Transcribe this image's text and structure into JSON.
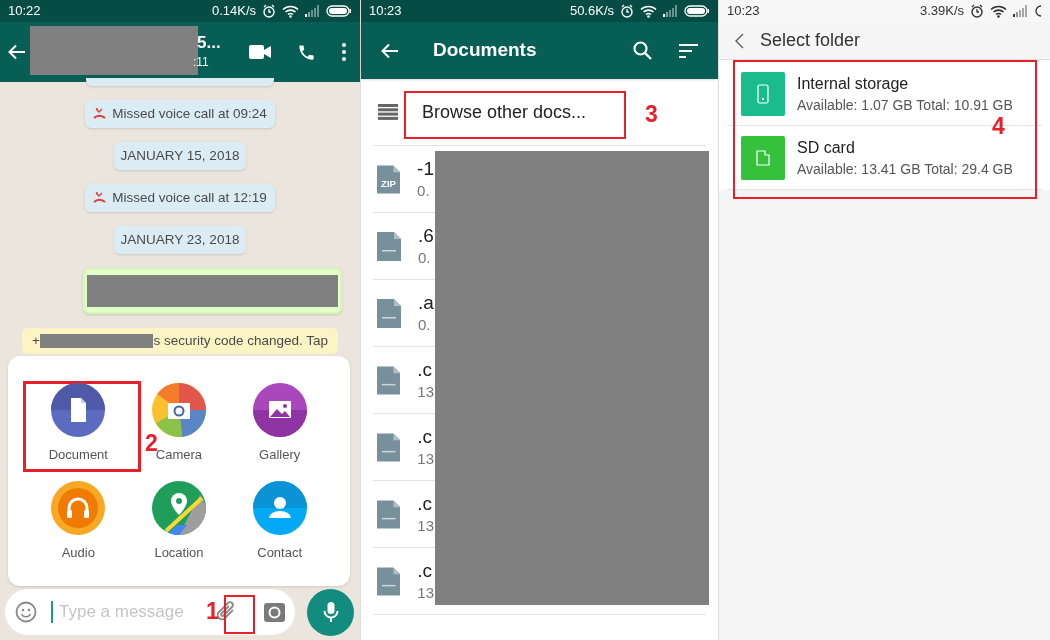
{
  "chat_screen": {
    "status_bar": {
      "time": "10:22",
      "speed": "0.14K/s"
    },
    "header": {
      "name_fragment": "5...",
      "status_fragment": ":11"
    },
    "messages": [
      {
        "kind": "cut"
      },
      {
        "kind": "call",
        "text": "Missed voice call at 09:24"
      },
      {
        "kind": "date",
        "text": "JANUARY 15, 2018"
      },
      {
        "kind": "call",
        "text": "Missed voice call at 12:19"
      },
      {
        "kind": "date",
        "text": "JANUARY 23, 2018"
      },
      {
        "kind": "redacted"
      },
      {
        "kind": "notice",
        "prefix": "+",
        "text": "s security code changed. Tap"
      }
    ],
    "attach_options": [
      {
        "kind": "document",
        "label": "Document"
      },
      {
        "kind": "camera",
        "label": "Camera"
      },
      {
        "kind": "gallery",
        "label": "Gallery"
      },
      {
        "kind": "audio",
        "label": "Audio"
      },
      {
        "kind": "location",
        "label": "Location"
      },
      {
        "kind": "contact",
        "label": "Contact"
      }
    ],
    "input": {
      "placeholder": "Type a message"
    },
    "annotations": [
      {
        "kind": "attach",
        "label": "1"
      },
      {
        "kind": "document",
        "label": "2"
      }
    ]
  },
  "documents_screen": {
    "status_bar": {
      "time": "10:23",
      "speed": "50.6K/s"
    },
    "title": "Documents",
    "browse_label": "Browse other docs...",
    "files": [
      {
        "kind": "zip",
        "icon_label": "ZIP",
        "name": "-1",
        "size": "0."
      },
      {
        "kind": "file",
        "name": ".6",
        "size": "0."
      },
      {
        "kind": "file",
        "name": ".a",
        "size": "0."
      },
      {
        "kind": "file",
        "name": ".c",
        "size": "13"
      },
      {
        "kind": "file",
        "name": ".c",
        "size": "13"
      },
      {
        "kind": "file",
        "name": ".c",
        "size": "13"
      },
      {
        "kind": "file",
        "name": ".c",
        "size": "13"
      }
    ],
    "annotation": {
      "label": "3"
    }
  },
  "folder_screen": {
    "status_bar": {
      "time": "10:23",
      "speed": "3.39K/s"
    },
    "title": "Select folder",
    "locations": [
      {
        "kind": "internal",
        "name": "Internal storage",
        "details": "Available: 1.07 GB Total: 10.91 GB"
      },
      {
        "kind": "sd",
        "name": "SD card",
        "details": "Available: 13.41 GB Total: 29.4 GB"
      }
    ],
    "annotation": {
      "label": "4"
    }
  }
}
